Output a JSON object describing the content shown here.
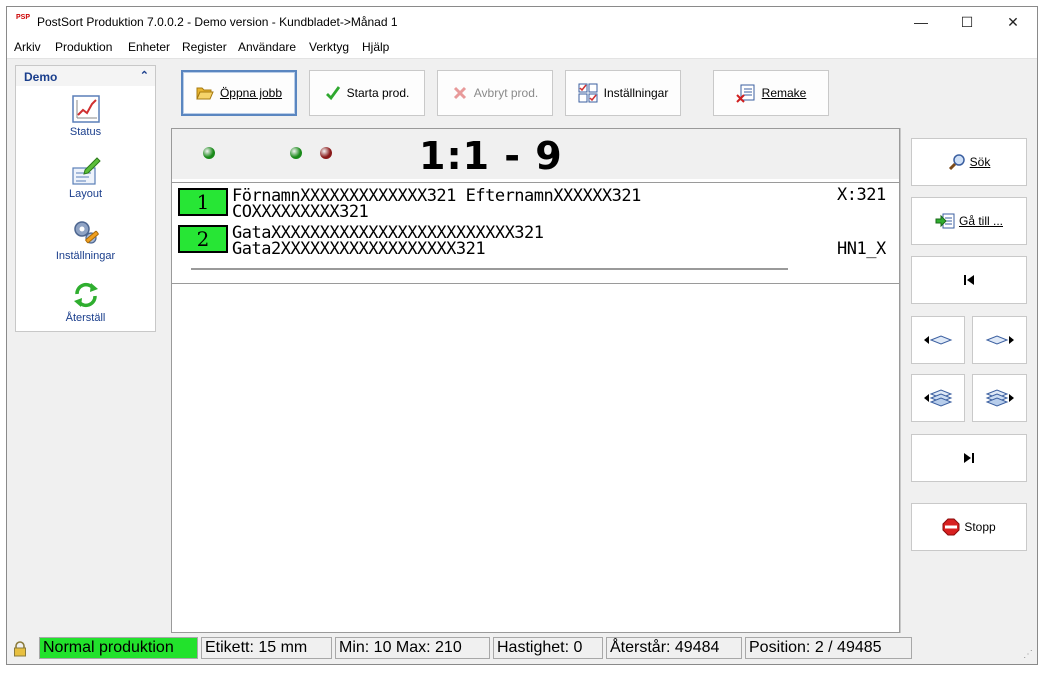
{
  "window": {
    "title": "PostSort Produktion 7.0.0.2  -  Demo version  -  Kundbladet->Månad 1",
    "logo_text": "PSP",
    "minimize_glyph": "—",
    "maximize_glyph": "☐",
    "close_glyph": "✕"
  },
  "menu": [
    "Arkiv",
    "Produktion",
    "Enheter",
    "Register",
    "Användare",
    "Verktyg",
    "Hjälp"
  ],
  "sidebar": {
    "title": "Demo",
    "collapse_glyph": "⌃",
    "items": [
      {
        "label": "Status",
        "icon": "chart-icon"
      },
      {
        "label": "Layout",
        "icon": "layout-pencil-icon"
      },
      {
        "label": "Inställningar",
        "icon": "gears-wrench-icon"
      },
      {
        "label": "Återställ",
        "icon": "refresh-icon"
      }
    ]
  },
  "toolbar": {
    "open_job": "Öppna jobb",
    "start_prod": "Starta prod.",
    "cancel_prod": "Avbryt prod.",
    "settings": "Inställningar",
    "remake": "Remake"
  },
  "counter": {
    "text": "1:1 - 9",
    "leds": [
      {
        "color": "#1a8a1a"
      },
      {
        "color": "#1a8a1a"
      },
      {
        "color": "#8a1a1a"
      }
    ]
  },
  "label_preview": {
    "line_numbers": [
      "1",
      "2"
    ],
    "lines": [
      "FörnamnXXXXXXXXXXXXX321 EfternamnXXXXXX321",
      "COXXXXXXXXX321",
      "GataXXXXXXXXXXXXXXXXXXXXXXXXX321",
      "Gata2XXXXXXXXXXXXXXXXXX321"
    ],
    "right_top": "X:321",
    "right_bottom": "HN1_X"
  },
  "right_panel": {
    "search": "Sök",
    "goto": "Gå till ...",
    "stop": "Stopp"
  },
  "statusbar": {
    "mode": "Normal produktion",
    "label": "Etikett: 15 mm",
    "minmax": "Min: 10  Max: 210",
    "speed": "Hastighet: 0",
    "remaining": "Återstår: 49484",
    "position": "Position: 2 / 49485"
  },
  "colors": {
    "accent_blue": "#1a3e8c",
    "status_green": "#22e22c",
    "line_badge_green": "#27e635"
  }
}
